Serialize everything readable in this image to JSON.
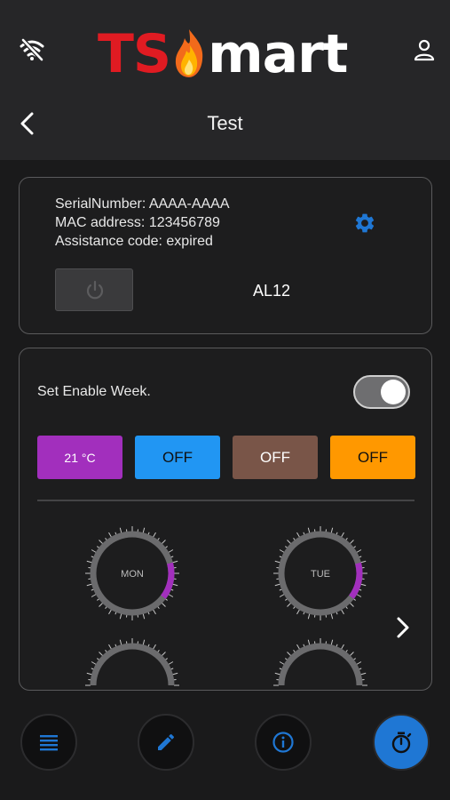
{
  "header": {
    "logo_left": "TS",
    "logo_right": "mart",
    "title": "Test"
  },
  "device": {
    "serial_line": "SerialNumber: AAAA-AAAA",
    "mac_line": "MAC address: 123456789",
    "assistance_line": "Assistance code: expired",
    "name": "AL12"
  },
  "week": {
    "label": "Set Enable Week.",
    "enabled": true
  },
  "modes": [
    {
      "label": "21 °C",
      "color": "#a22fbd"
    },
    {
      "label": "OFF",
      "color": "#2196f3"
    },
    {
      "label": "OFF",
      "color": "#795548"
    },
    {
      "label": "OFF",
      "color": "#ff9800"
    }
  ],
  "days": [
    {
      "label": "MON"
    },
    {
      "label": "TUE"
    }
  ],
  "colors": {
    "accent": "#1f77d4",
    "arc_purple": "#a22fbd",
    "ring_gray": "#6b6b6d",
    "logo_red": "#e01b22"
  },
  "icons": {
    "wifi": "wifi-off-icon",
    "user": "user-icon",
    "back": "chevron-left-icon",
    "settings": "gear-icon",
    "power": "power-icon",
    "next": "chevron-right-icon",
    "nav": [
      "list-icon",
      "pencil-icon",
      "info-icon",
      "stopwatch-icon"
    ]
  }
}
